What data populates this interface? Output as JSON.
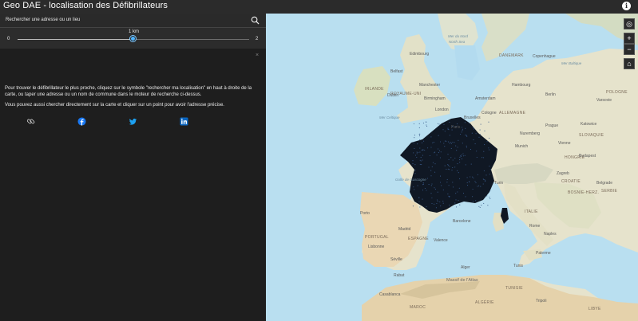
{
  "header": {
    "title": "Geo DAE - localisation des Défibrillateurs",
    "info_icon": "info-icon"
  },
  "search": {
    "placeholder": "Rechercher une adresse ou un lieu",
    "icon": "search-icon"
  },
  "distance_slider": {
    "value_label": "1 km",
    "min_label": "0",
    "max_label": "2",
    "value": 1,
    "min": 0,
    "max": 2
  },
  "panel": {
    "close_label": "×",
    "paragraph1": "Pour trouver le défibrillateur le plus proche, cliquez sur le symbole \"rechercher ma localisation\" en haut à droite de la carte, ou taper une adresse ou un nom de commune dans le moteur de recherche ci-dessus.",
    "paragraph2": "Vous pouvez aussi chercher directement sur la carte et cliquer sur un point pour avoir l'adresse précise.",
    "share": [
      {
        "name": "link-icon",
        "color": "#cfcfcf"
      },
      {
        "name": "facebook-icon",
        "color": "#1877f2"
      },
      {
        "name": "twitter-icon",
        "color": "#1da1f2"
      },
      {
        "name": "linkedin-icon",
        "color": "#0a66c2"
      }
    ]
  },
  "map": {
    "tools": [
      "locate-icon",
      "zoom-in-icon",
      "zoom-out-icon",
      "home-icon"
    ],
    "zoom_in": "+",
    "zoom_out": "−",
    "labels": {
      "mer_du_nord": "Mer du Nord",
      "north_sea": "North Sea",
      "danemark": "DANEMARK",
      "copenhague": "Copenhague",
      "edimbourg": "Edimbourg",
      "belfast": "Belfast",
      "manchester": "Manchester",
      "irlande": "IRLANDE",
      "royaume_uni": "ROYAUME-UNI",
      "birmingham": "Birmingham",
      "dublin": "Dublin",
      "hambourg": "Hambourg",
      "mer_baltique": "Mer Baltique",
      "pologne": "POLOGNE",
      "varsovie": "Varsovie",
      "berlin": "Berlin",
      "amsterdam": "Amsterdam",
      "london": "London",
      "cologne": "Cologne",
      "bruxelles": "Bruxelles",
      "allemagne": "ALLEMAGNE",
      "prague": "Prague",
      "katowice": "Katowice",
      "paris": "Paris",
      "mer_celtique": "Mer Celtique",
      "nuremberg": "Nuremberg",
      "munich": "Munich",
      "vienne": "Vienne",
      "slovaquie": "SLOVAQUIE",
      "hongrie": "HONGRIE",
      "budapest": "Budapest",
      "golfe_gascogne": "Golfe de Gascogne",
      "turin": "Turin",
      "zagreb": "Zagreb",
      "croatie": "CROATIE",
      "bosnie": "BOSNIE-HERZ.",
      "serbie": "SERBIE",
      "belgrade": "Belgrade",
      "porto": "Porto",
      "barcelone": "Barcelone",
      "italie": "ITALIE",
      "rome": "Rome",
      "naples": "Naples",
      "madrid": "Madrid",
      "espagne": "ESPAGNE",
      "portugal": "PORTUGAL",
      "lisbonne": "Lisbonne",
      "valence": "Valence",
      "seville": "Séville",
      "palerme": "Palerme",
      "tunis": "Tunis",
      "tunisie": "TUNISIE",
      "alger": "Alger",
      "rabat": "Rabat",
      "massif_atlas": "Massif de l'Atlas",
      "casablanca": "Casablanca",
      "tripoli": "Tripoli",
      "maroc": "MAROC",
      "algerie": "ALGÉRIE",
      "libye": "LIBYE"
    }
  }
}
